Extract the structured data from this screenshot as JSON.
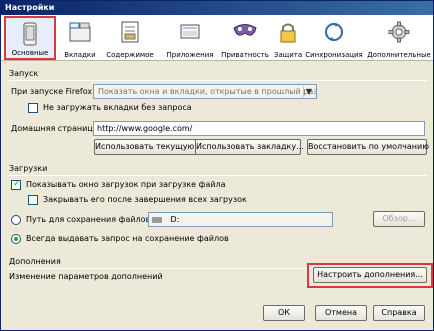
{
  "window": {
    "title": "Настройки"
  },
  "toolbar": {
    "items": [
      {
        "label": "Основные",
        "selected": true
      },
      {
        "label": "Вкладки"
      },
      {
        "label": "Содержимое"
      },
      {
        "label": "Приложения"
      },
      {
        "label": "Приватность"
      },
      {
        "label": "Защита"
      },
      {
        "label": "Синхронизация"
      },
      {
        "label": "Дополнительные"
      }
    ]
  },
  "startup": {
    "group_title": "Запуск",
    "on_start_label": "При запуске Firefox:",
    "on_start_value": "Показать окна и вкладки, открытые в прошлый раз",
    "dont_load_tabs_label": "Не загружать вкладки без запроса",
    "homepage_label": "Домашняя страница:",
    "homepage_value": "http://www.google.com/",
    "use_current_button": "Использовать текущую страницу",
    "use_bookmark_button": "Использовать закладку...",
    "restore_default_button": "Восстановить по умолчанию"
  },
  "downloads": {
    "group_title": "Загрузки",
    "show_window_label": "Показывать окно загрузок при загрузке файла",
    "close_after_label": "Закрывать его после завершения всех загрузок",
    "save_path_label": "Путь для сохранения файлов",
    "save_path_value": "D:",
    "browse_button": "Обзор...",
    "always_ask_label": "Всегда выдавать запрос на сохранение файлов"
  },
  "addons": {
    "group_title": "Дополнения",
    "desc": "Изменение параметров дополнений",
    "configure_button": "Настроить дополнения..."
  },
  "footer": {
    "ok": "ОК",
    "cancel": "Отмена",
    "help": "Справка"
  }
}
